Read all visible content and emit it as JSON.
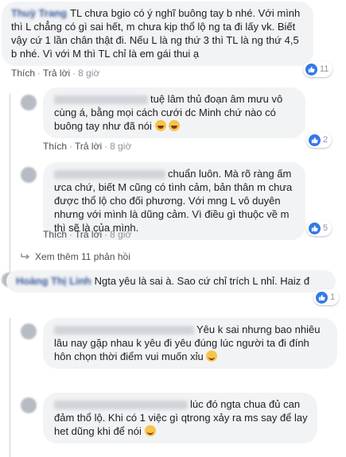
{
  "comments": [
    {
      "author": "Thuỳ Trang",
      "text": "TL chưa bgio có ý nghĩ buông tay b nhé. Với mình thì L chẳng có gì sai hết, m chưa kịp thổ lộ ng ta đi lấy vk. Biết vậy cứ 1 lần chân thật đi. Nếu L là ng thứ 3 thì TL là ng thứ 4,5 b nhé. Vì với M thì TL chỉ là em gái thui ạ",
      "actions": {
        "like": "Thích",
        "reply": "Trả lời",
        "time": "8 giờ"
      },
      "reaction_count": "11"
    },
    {
      "author": "Minh Anh",
      "text": "tuệ lâm thủ đoạn âm mưu vô cùng á, bằng mọi cách cưới dc Minh chứ nào có buông tay như đã nói",
      "emojis": [
        "laughing-emoji",
        "laughing-emoji"
      ],
      "actions": {
        "like": "Thích",
        "reply": "Trả lời",
        "time": "8 giờ"
      },
      "reaction_count": "2"
    },
    {
      "author": "Ngọc Hà",
      "text": "chuẩn luôn. Mà rõ ràng ấm ưca chứ, biết M cũng có tình cảm, bản thân m chưa được thổ lộ cho đối phương. Với mng L vô duyên nhưng với mình là dũng cảm. Vì điều gì thuộc về m thì sẽ là của mình.",
      "actions": {
        "like": "Thích",
        "reply": "Trả lời",
        "time": "8 giờ"
      },
      "reaction_count": "5"
    },
    {
      "author": "Hoàng Thị Linh",
      "text": "Ngta yêu là sai à. Sao cứ chỉ trích L nhỉ. Haiz đ",
      "reaction_count": "1"
    },
    {
      "author": "Bảo Ngọc",
      "text": "Yêu k sai nhưng bao nhiêu lâu nay gặp nhau k yêu đi yêu đúng lúc người ta đi đính hôn chọn thời điểm vui muốn xỉu",
      "emojis": [
        "smiling-emoji"
      ]
    },
    {
      "author": "Thanh Hương",
      "text": "lúc đó ngta chua đủ can đảm thổ lộ. Khi có 1 việc gì qtrong xảy ra ms say để lay het dũng khi để nói",
      "emojis": [
        "smiling-emoji"
      ]
    }
  ],
  "more_replies": "Xem thêm 11 phản hồi",
  "colors": {
    "like_blue": "#3578e5",
    "bubble_bg": "#f2f3f5",
    "meta_text": "#90949c"
  }
}
